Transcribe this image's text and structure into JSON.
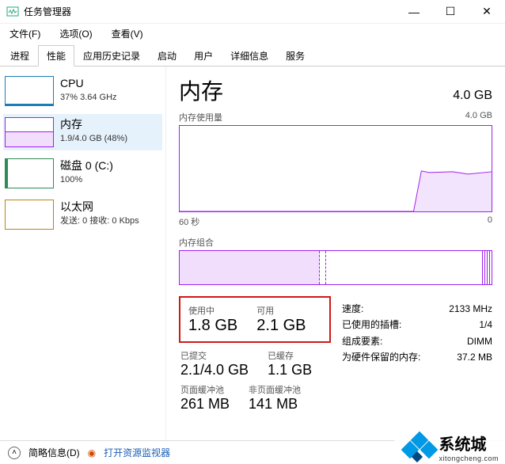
{
  "titlebar": {
    "title": "任务管理器"
  },
  "menubar": {
    "file": "文件(F)",
    "options": "选项(O)",
    "view": "查看(V)"
  },
  "tabs": {
    "processes": "进程",
    "performance": "性能",
    "apphistory": "应用历史记录",
    "startup": "启动",
    "users": "用户",
    "details": "详细信息",
    "services": "服务"
  },
  "sidebar": {
    "cpu": {
      "title": "CPU",
      "sub": "37% 3.64 GHz"
    },
    "mem": {
      "title": "内存",
      "sub": "1.9/4.0 GB (48%)"
    },
    "disk": {
      "title": "磁盘 0 (C:)",
      "sub": "100%"
    },
    "net": {
      "title": "以太网",
      "sub": "发送: 0 接收: 0 Kbps"
    }
  },
  "content": {
    "heading": "内存",
    "total": "4.0 GB",
    "usage_label": "内存使用量",
    "usage_max": "4.0 GB",
    "time_label": "60 秒",
    "time_right": "0",
    "comp_label": "内存组合",
    "stats": {
      "in_use_label": "使用中",
      "in_use": "1.8 GB",
      "available_label": "可用",
      "available": "2.1 GB",
      "committed_label": "已提交",
      "committed": "2.1/4.0 GB",
      "cached_label": "已缓存",
      "cached": "1.1 GB",
      "paged_label": "页面缓冲池",
      "paged": "261 MB",
      "nonpaged_label": "非页面缓冲池",
      "nonpaged": "141 MB"
    },
    "right": {
      "speed_label": "速度:",
      "speed": "2133 MHz",
      "slots_label": "已使用的插槽:",
      "slots": "1/4",
      "form_label": "组成要素:",
      "form": "DIMM",
      "reserved_label": "为硬件保留的内存:",
      "reserved": "37.2 MB"
    }
  },
  "footer": {
    "less": "简略信息(D)",
    "resmon": "打开资源监视器"
  },
  "watermark": {
    "text": "系统城",
    "url": "xitongcheng.com"
  },
  "chart_data": {
    "type": "line",
    "title": "内存使用量",
    "xlabel": "60 秒",
    "ylabel": "",
    "ylim": [
      0,
      4.0
    ],
    "x": [
      60,
      55,
      50,
      45,
      40,
      35,
      30,
      25,
      20,
      15,
      10,
      5,
      0
    ],
    "values": [
      0,
      0,
      0,
      0,
      0,
      0,
      0,
      0,
      0,
      0,
      1.9,
      1.85,
      1.9
    ],
    "unit": "GB"
  }
}
